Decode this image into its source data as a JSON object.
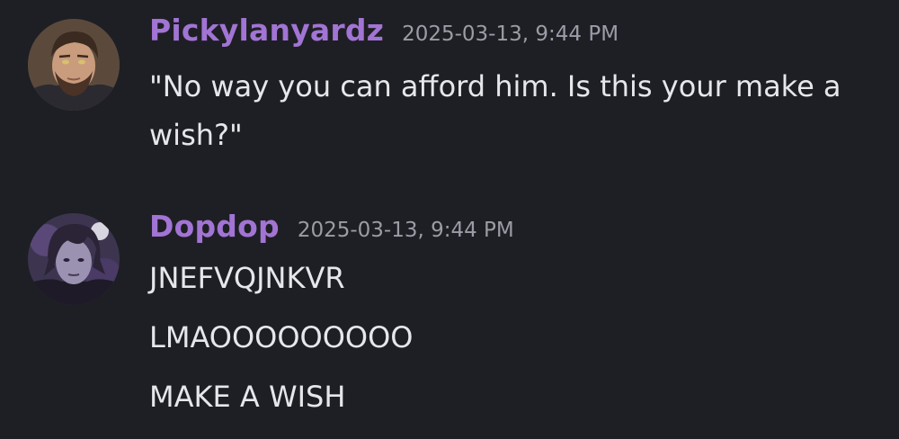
{
  "messages": [
    {
      "username": "Pickylanyardz",
      "timestamp": "2025-03-13, 9:44 PM",
      "text": "\"No way you can afford him. Is this your make a wish?\"",
      "username_color": "#a274d4"
    },
    {
      "username": "Dopdop",
      "timestamp": "2025-03-13, 9:44 PM",
      "lines": [
        "JNEFVQJNKVR",
        "LMAOOOOOOOOO",
        "MAKE A WISH"
      ],
      "username_color": "#a274d4"
    }
  ],
  "colors": {
    "background": "#1e1f24",
    "text": "#e6e7ea",
    "timestamp": "#9a9ca6"
  }
}
